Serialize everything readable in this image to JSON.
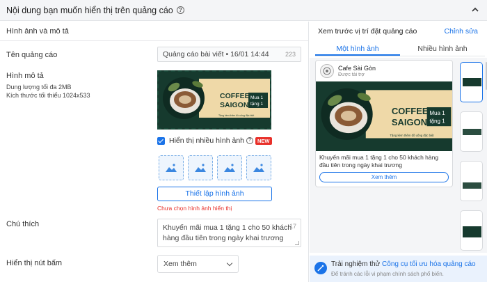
{
  "header": {
    "title": "Nội dung bạn muốn hiển thị trên quảng cáo",
    "help_icon": "?"
  },
  "form": {
    "section_title": "Hình ảnh và mô tả",
    "ad_name": {
      "label": "Tên quảng cáo",
      "value": "Quảng cáo bài viết • 16/01 14:44",
      "count": "223"
    },
    "image": {
      "label": "Hình mô tả",
      "capacity": "Dung lượng tối đa 2MB",
      "min_size": "Kích thước tối thiểu 1024x533",
      "multi_image_label": "Hiển thị nhiều hình ảnh",
      "help_icon": "?",
      "new_badge": "NEW",
      "setup_button": "Thiết lập hình ảnh",
      "error": "Chưa chọn hình ảnh hiển thị"
    },
    "caption": {
      "label": "Chú thích",
      "value": "Khuyến mãi mua 1 tặng 1 cho 50 khách hàng đầu tiên trong ngày khai trương",
      "count": "17"
    },
    "button": {
      "label": "Hiển thị nút bấm",
      "selected": "Xem thêm"
    }
  },
  "ad_creative": {
    "line1": "COFFEE",
    "line2": "SAIGON",
    "promo1": "Mua 1",
    "promo2": "tặng 1",
    "fine_print": "Tặng kèm thêm đồ uống đặc biệt",
    "colors": {
      "dark_green": "#163a2e",
      "cream": "#efd9a8",
      "text_green": "#163a2e"
    }
  },
  "preview": {
    "title": "Xem trước vị trí đặt quảng cáo",
    "edit_link": "Chỉnh sửa",
    "tabs": [
      "Một hình ảnh",
      "Nhiều hình ảnh"
    ],
    "active_tab": 0,
    "page_name": "Cafe Sài Gòn",
    "sponsored": "Được tài trợ",
    "card_text": "Khuyến mãi mua 1 tặng 1 cho 50 khách hàng đầu tiên trong ngày khai trương",
    "card_button": "Xem thêm"
  },
  "tip": {
    "prefix": "Trải nghiệm thử ",
    "link": "Công cụ tối ưu hóa quảng cáo",
    "sub": "Để tránh các lỗi vi phạm chính sách phổ biến."
  },
  "accent": "#1a73e8"
}
